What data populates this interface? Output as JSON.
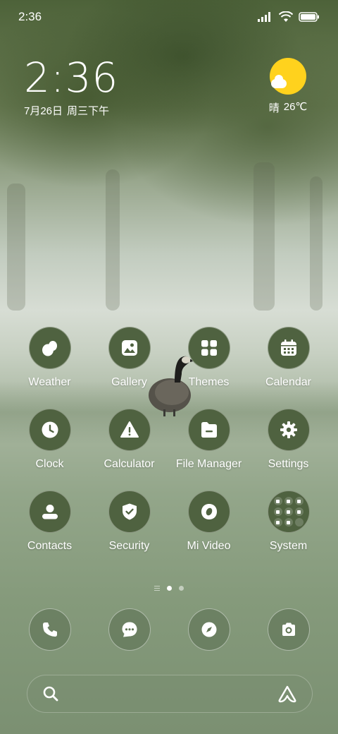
{
  "status_bar": {
    "time": "2:36",
    "icons": [
      "signal-icon",
      "wifi-icon",
      "battery-icon"
    ]
  },
  "clock_widget": {
    "time": "2:36",
    "date": "7月26日",
    "weekday_period": "周三下午"
  },
  "weather_widget": {
    "icon": "sunny-cloud-icon",
    "condition": "晴",
    "temperature": "26℃"
  },
  "apps": [
    {
      "label": "Weather",
      "icon": "weather-icon"
    },
    {
      "label": "Gallery",
      "icon": "gallery-icon"
    },
    {
      "label": "Themes",
      "icon": "themes-icon"
    },
    {
      "label": "Calendar",
      "icon": "calendar-icon"
    },
    {
      "label": "Clock",
      "icon": "clock-icon"
    },
    {
      "label": "Calculator",
      "icon": "calculator-icon"
    },
    {
      "label": "File Manager",
      "icon": "file-manager-icon"
    },
    {
      "label": "Settings",
      "icon": "settings-icon"
    },
    {
      "label": "Contacts",
      "icon": "contacts-icon"
    },
    {
      "label": "Security",
      "icon": "security-icon"
    },
    {
      "label": "Mi Video",
      "icon": "mi-video-icon"
    },
    {
      "label": "System",
      "icon": "system-folder-icon"
    }
  ],
  "page_indicator": {
    "pages": 2,
    "active_page": 1
  },
  "dock": [
    {
      "icon": "phone-icon"
    },
    {
      "icon": "messages-icon"
    },
    {
      "icon": "browser-icon"
    },
    {
      "icon": "camera-icon"
    }
  ],
  "search_bar": {
    "left_icon": "search-icon",
    "right_icon": "assistant-icon"
  },
  "colors": {
    "icon_bg": "#4f6240",
    "sun": "#ffd21d",
    "text": "#ffffff"
  }
}
